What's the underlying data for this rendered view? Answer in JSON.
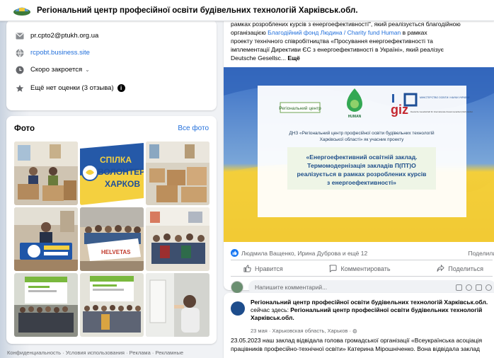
{
  "header": {
    "title": "Регіональний центр професійної освіти будівельних технологій Харківськ.обл."
  },
  "info": {
    "email": "pr.cpto2@ptukh.org.ua",
    "website": "rcpobt.business.site",
    "hours": "Скоро закроется",
    "rating": "Ещё нет оценки (3 отзыва)"
  },
  "photos": {
    "heading": "Фото",
    "see_all": "Все фото",
    "items": [
      {
        "alt": "volunteers-with-boxes"
      },
      {
        "alt": "spilka-volonteriv-kharkova-logo",
        "text_line1": "СПІЛКА",
        "text_line2": "ВОЛОНТЕР",
        "text_line3": "ХАРКОВ"
      },
      {
        "alt": "boxes-in-room"
      },
      {
        "alt": "man-with-banner"
      },
      {
        "alt": "group-with-helvetas-banner",
        "banner": "HELVETAS"
      },
      {
        "alt": "group-in-hall"
      },
      {
        "alt": "conference-stage-1"
      },
      {
        "alt": "conference-stage-2"
      },
      {
        "alt": "woman-at-wall"
      }
    ]
  },
  "footer": {
    "links": "Конфиденциальность · Условия использования · Реклама · Рекламные"
  },
  "post": {
    "text_line1": "рамках розроблених курсів з енергоефективності\", який реалізується благодійною",
    "text_line2_prefix": "організацією ",
    "text_link": "Благодійний фонд Людина / Charity fund Human",
    "text_line2_suffix": " в рамках",
    "text_line3": "проекту технічного співробітництва «Просування енергоефективності та",
    "text_line4": "імплементації Директиви ЄС з енергоефективності в Україні», який реалізує",
    "text_line5": "Deutsche Gesellsc... ",
    "more": "Ещё",
    "image": {
      "logo1": "Регіональний центр",
      "logo2": "HUMAN",
      "logo3": "giz",
      "ministry": "МІНІСТЕРСТВО ОСВІТИ І НАУКИ УКРАЇНИ",
      "giz_sub": "Deutsche Gesellschaft für Internationale Zusammenarbeit (GIZ) GmbH",
      "subtitle_line1": "ДНЗ «Регіональний центр професійної освіти будівельних технологій",
      "subtitle_line2": "Харківської області» як учасник проекту",
      "main_line1": "«Енергоефективний освітній заклад.",
      "main_line2": "Термомодернізація закладів П(ПТ)О",
      "main_line3": "реалізується в рамках розроблених курсів",
      "main_line4": "з енергоефективності»"
    },
    "reactions_text": "Людмила Ващенко, Ирина Дуброва и ещё 12",
    "shares_text": "Поделили",
    "like_label": "Нравится",
    "comment_label": "Комментировать",
    "share_label": "Поделиться",
    "comment_placeholder": "Напишите комментарий..."
  },
  "post2": {
    "author": "Регіональний центр професійної освіти будівельних технологій Харківськ.обл.",
    "status_prefix": "сейчас здесь: ",
    "location": "Регіональний центр професійної освіти будівельних технологій Харківськ.обл.",
    "meta": "23 мая · Харьковская область, Харьков · ",
    "body_line1": "23.05.2023 наш заклад відвідала голова громадської організації «Всеукраїнська асоціація",
    "body_line2": "працівників професійно-технічної освіти» Катерина Мірошніченко. Вона відвідала заклад"
  },
  "colors": {
    "link": "#216fdb",
    "flag_blue": "#2f68c4",
    "flag_yellow": "#f3cf3b",
    "facebook_blue": "#1877f2"
  }
}
